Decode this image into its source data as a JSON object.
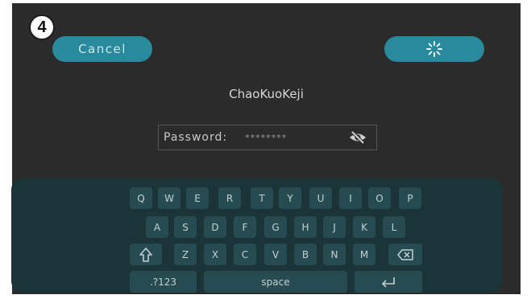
{
  "step_number": "4",
  "header": {
    "cancel_label": "Cancel",
    "confirm_icon": "loading-spinner-icon"
  },
  "network": {
    "name": "ChaoKuoKeji"
  },
  "password_field": {
    "label": "Password:",
    "value": "********",
    "toggle_icon": "eye-slash-icon"
  },
  "keyboard": {
    "rows": [
      [
        "Q",
        "W",
        "E",
        "R",
        "T",
        "Y",
        "U",
        "I",
        "O",
        "P"
      ],
      [
        "A",
        "S",
        "D",
        "F",
        "G",
        "H",
        "J",
        "K",
        "L"
      ],
      [
        "Z",
        "X",
        "C",
        "V",
        "B",
        "N",
        "M"
      ]
    ],
    "shift_icon": "shift-arrow-icon",
    "backspace_icon": "backspace-icon",
    "numbers_label": ".?123",
    "space_label": "space",
    "enter_icon": "enter-return-icon"
  },
  "colors": {
    "screen_bg": "#2b2b2b",
    "accent": "#2a8a9d",
    "keyboard_bg": "#1b3438",
    "key_bg": "#264c52"
  }
}
